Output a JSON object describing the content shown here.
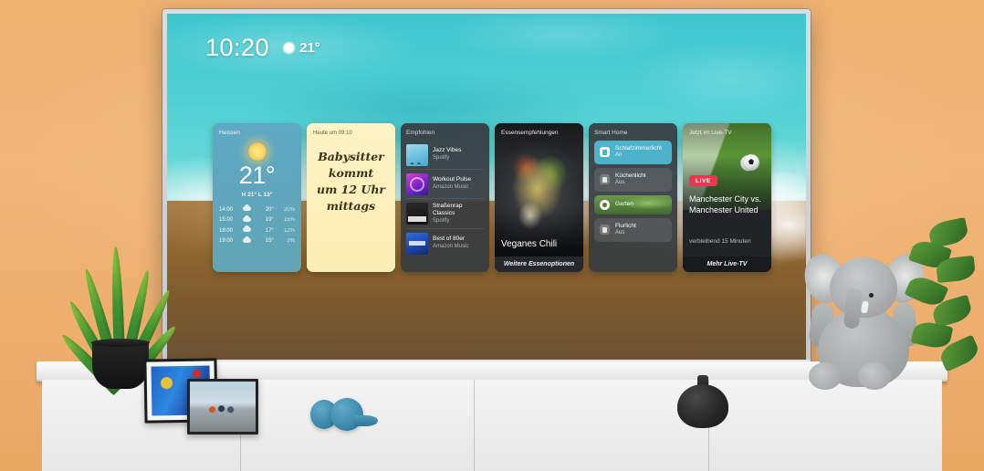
{
  "scene": {
    "description": "Living room wall with a smart TV showing a widget home screen",
    "wall_color": "#eeb170",
    "console_color": "#f2f2f2"
  },
  "tv": {
    "wallpaper": "aerial-beach-turquoise-water",
    "statusbar": {
      "clock": "10:20",
      "weather_icon": "sun-icon",
      "temperature": "21°"
    }
  },
  "widgets": {
    "weather": {
      "city": "Hessen",
      "icon": "sun-icon",
      "temperature": "21°",
      "high_low": "H 21° L 13°",
      "hourly": [
        {
          "time": "14:00",
          "icon": "cloud-icon",
          "temp": "20°",
          "precip": "20%"
        },
        {
          "time": "15:00",
          "icon": "cloud-icon",
          "temp": "19°",
          "precip": "15%"
        },
        {
          "time": "18:00",
          "icon": "cloud-icon",
          "temp": "17°",
          "precip": "12%"
        },
        {
          "time": "19:00",
          "icon": "cloud-icon",
          "temp": "15°",
          "precip": "2%"
        }
      ]
    },
    "note": {
      "header": "Heute um 09:10",
      "line1": "Babysitter",
      "line2": "kommt",
      "line3": "um 12 Uhr",
      "line4": "mittags"
    },
    "music": {
      "title": "Empfohlen",
      "tracks": [
        {
          "name": "Jazz Vibes",
          "source": "Spotify",
          "art": "palm-tree-artwork"
        },
        {
          "name": "Workout Pulse",
          "source": "Amazon Music",
          "art": "purple-artwork"
        },
        {
          "name": "Straßenrap Classics",
          "source": "Spotify",
          "art": "dark-artwork"
        },
        {
          "name": "Best of 80er",
          "source": "Amazon Music",
          "art": "blue-artwork"
        }
      ]
    },
    "food": {
      "title": "Essensempfehlungen",
      "dish": "Veganes Chili",
      "more_label": "Weitere Essenoptionen",
      "photo": "chili-bowl-photo"
    },
    "smarthome": {
      "title": "Smart Home",
      "devices": [
        {
          "name": "Schlafzimmerlicht",
          "state": "An",
          "icon": "light-panel-icon",
          "active": true
        },
        {
          "name": "Küchenlicht",
          "state": "Aus",
          "icon": "bulb-icon",
          "active": false
        },
        {
          "name": "Garten",
          "state": "",
          "icon": "camera-icon",
          "active": false,
          "photo": "garden-camera-photo"
        },
        {
          "name": "Flurlicht",
          "state": "Aus",
          "icon": "bulb-icon",
          "active": false
        }
      ]
    },
    "livetv": {
      "title": "Jetzt im Live-TV",
      "badge": "LIVE",
      "match": "Manchester City vs. Manchester United",
      "remaining": "verbleibend 15 Minuten",
      "more_label": "Mehr Live-TV",
      "photo": "soccer-ball-pitch-photo"
    }
  },
  "decor": {
    "plant": "snake-plant",
    "frame_big": "blue-abstract-artwork-frame",
    "frame_small": "bench-photo-frame",
    "headphones": "blue-over-ear-headphones",
    "vase": "black-round-vase",
    "plush": "gray-elephant-plush",
    "side_plant": "green-leafy-plant"
  },
  "colors": {
    "accent_teal": "#4db3cb",
    "live_red": "#e8384f",
    "note_yellow": "#fbeeb2",
    "water": "#4fd0d4",
    "sand": "#8c6531"
  }
}
